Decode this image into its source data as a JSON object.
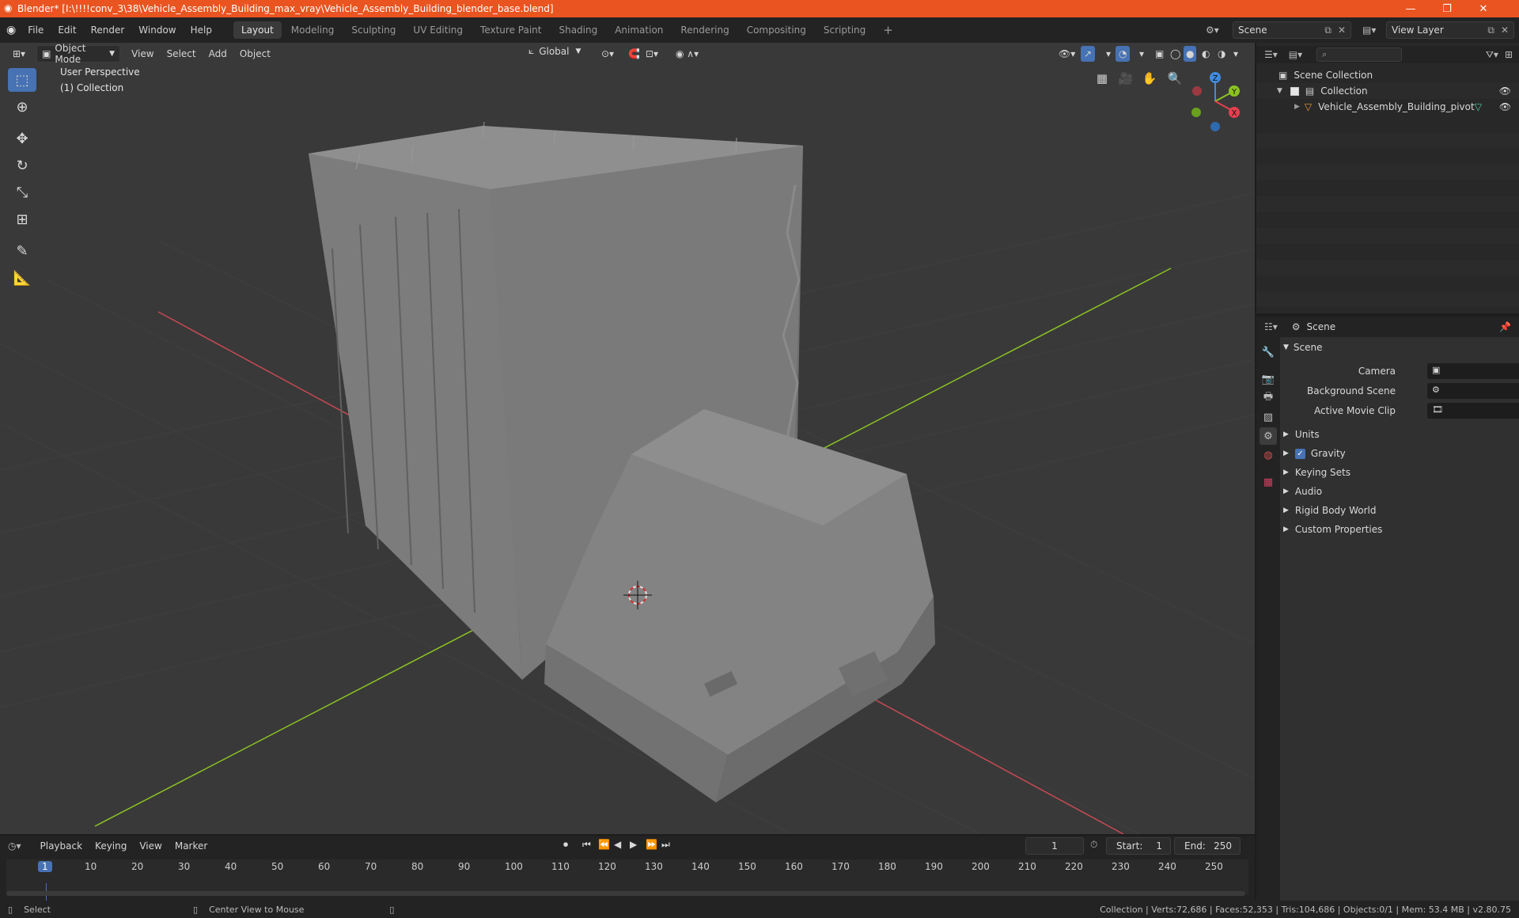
{
  "title_bar": {
    "title": "Blender* [I:\\!!!!conv_3\\38\\Vehicle_Assembly_Building_max_vray\\Vehicle_Assembly_Building_blender_base.blend]",
    "minimize": "—",
    "maximize": "❐",
    "close": "✕"
  },
  "menu": {
    "items": [
      "File",
      "Edit",
      "Render",
      "Window",
      "Help"
    ]
  },
  "workspaces": {
    "tabs": [
      "Layout",
      "Modeling",
      "Sculpting",
      "UV Editing",
      "Texture Paint",
      "Shading",
      "Animation",
      "Rendering",
      "Compositing",
      "Scripting"
    ],
    "active": "Layout",
    "add": "+"
  },
  "scene_selector": {
    "value": "Scene"
  },
  "view_layer_selector": {
    "value": "View Layer"
  },
  "viewport": {
    "mode": "Object Mode",
    "menus": [
      "View",
      "Select",
      "Add",
      "Object"
    ],
    "orientation": "Global",
    "overlay_line1": "User Perspective",
    "overlay_line2": "(1) Collection",
    "gizmo": {
      "z": "Z",
      "y": "Y",
      "x": "X"
    }
  },
  "outliner": {
    "root": "Scene Collection",
    "collection": "Collection",
    "object": "Vehicle_Assembly_Building_pivot"
  },
  "properties": {
    "context": "Scene",
    "panel": "Scene",
    "camera_label": "Camera",
    "background_scene_label": "Background Scene",
    "active_movie_clip_label": "Active Movie Clip",
    "sections": [
      "Units",
      "Gravity",
      "Keying Sets",
      "Audio",
      "Rigid Body World",
      "Custom Properties"
    ],
    "gravity_checked": true
  },
  "timeline": {
    "menus": [
      "Playback",
      "Keying",
      "View",
      "Marker"
    ],
    "current_frame": "1",
    "start_label": "Start:",
    "start": "1",
    "end_label": "End:",
    "end": "250",
    "ticks": [
      "1",
      "10",
      "20",
      "30",
      "40",
      "50",
      "60",
      "70",
      "80",
      "90",
      "100",
      "110",
      "120",
      "130",
      "140",
      "150",
      "160",
      "170",
      "180",
      "190",
      "200",
      "210",
      "220",
      "230",
      "240",
      "250"
    ]
  },
  "status_bar": {
    "left_action": "Select",
    "mid_action": "Center View to Mouse",
    "stats": "Collection | Verts:72,686 | Faces:52,353 | Tris:104,686 | Objects:0/1 | Mem: 53.4 MB | v2.80.75"
  },
  "colors": {
    "accent": "#4772b3",
    "title_bar": "#e95420",
    "x_axis": "#e6404f",
    "y_axis": "#8bc322",
    "z_axis": "#3f8ce0"
  }
}
